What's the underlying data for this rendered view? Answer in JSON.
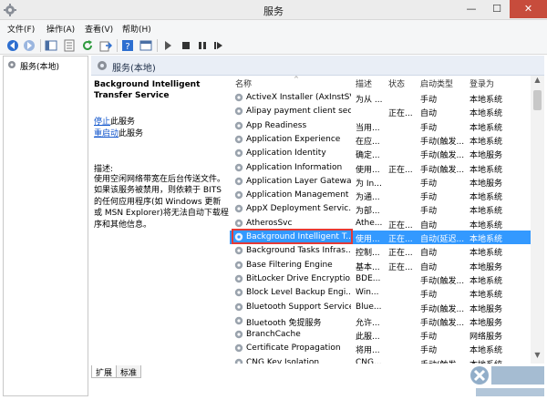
{
  "window": {
    "title": "服务",
    "minimize": "—",
    "maximize": "☐",
    "close": "✕"
  },
  "menu": [
    {
      "label": "文件(F)"
    },
    {
      "label": "操作(A)"
    },
    {
      "label": "查看(V)"
    },
    {
      "label": "帮助(H)"
    }
  ],
  "toolbar": {
    "icons": [
      "back-icon",
      "forward-icon",
      "show-hide-tree-icon",
      "properties-icon",
      "refresh-icon",
      "export-icon",
      "help-icon",
      "mmc-icon",
      "play-icon",
      "stop-icon",
      "pause-icon",
      "restart-icon"
    ]
  },
  "tree": {
    "root_label": "服务(本地)"
  },
  "panel": {
    "header_label": "服务(本地)"
  },
  "description": {
    "service_name": "Background Intelligent Transfer Service",
    "stop_link": "停止",
    "stop_suffix": "此服务",
    "restart_link": "重启动",
    "restart_suffix": "此服务",
    "label": "描述:",
    "text": "使用空闲网络带宽在后台传送文件。如果该服务被禁用，则依赖于 BITS 的任何应用程序(如 Windows 更新或 MSN Explorer)将无法自动下载程序和其他信息。"
  },
  "columns": {
    "name": "名称",
    "desc": "描述",
    "status": "状态",
    "startup": "启动类型",
    "logon": "登录为",
    "sort_indicator": "^"
  },
  "services": [
    {
      "name": "ActiveX Installer (AxInstSV)",
      "desc": "为从 ...",
      "status": "",
      "startup": "手动",
      "logon": "本地系统",
      "selected": false
    },
    {
      "name": "Alipay payment client sec...",
      "desc": "",
      "status": "正在...",
      "startup": "自动",
      "logon": "本地系统",
      "selected": false
    },
    {
      "name": "App Readiness",
      "desc": "当用...",
      "status": "",
      "startup": "手动",
      "logon": "本地系统",
      "selected": false
    },
    {
      "name": "Application Experience",
      "desc": "在应...",
      "status": "",
      "startup": "手动(触发...",
      "logon": "本地系统",
      "selected": false
    },
    {
      "name": "Application Identity",
      "desc": "确定...",
      "status": "",
      "startup": "手动(触发...",
      "logon": "本地服务",
      "selected": false
    },
    {
      "name": "Application Information",
      "desc": "使用...",
      "status": "正在...",
      "startup": "手动(触发...",
      "logon": "本地系统",
      "selected": false
    },
    {
      "name": "Application Layer Gatewa...",
      "desc": "为 In...",
      "status": "",
      "startup": "手动",
      "logon": "本地服务",
      "selected": false
    },
    {
      "name": "Application Management",
      "desc": "为通...",
      "status": "",
      "startup": "手动",
      "logon": "本地系统",
      "selected": false
    },
    {
      "name": "AppX Deployment Servic...",
      "desc": "为部...",
      "status": "",
      "startup": "手动",
      "logon": "本地系统",
      "selected": false
    },
    {
      "name": "AtherosSvc",
      "desc": "Athe...",
      "status": "正在...",
      "startup": "自动",
      "logon": "本地系统",
      "selected": false
    },
    {
      "name": "Background Intelligent T...",
      "desc": "使用...",
      "status": "正在...",
      "startup": "自动(延迟...",
      "logon": "本地系统",
      "selected": true
    },
    {
      "name": "Background Tasks Infras...",
      "desc": "控制...",
      "status": "正在...",
      "startup": "自动",
      "logon": "本地系统",
      "selected": false
    },
    {
      "name": "Base Filtering Engine",
      "desc": "基本...",
      "status": "正在...",
      "startup": "自动",
      "logon": "本地服务",
      "selected": false
    },
    {
      "name": "BitLocker Drive Encryptio...",
      "desc": "BDE...",
      "status": "",
      "startup": "手动(触发...",
      "logon": "本地系统",
      "selected": false
    },
    {
      "name": "Block Level Backup Engi...",
      "desc": "Win...",
      "status": "",
      "startup": "手动",
      "logon": "本地系统",
      "selected": false
    },
    {
      "name": "Bluetooth Support Service",
      "desc": "Blue...",
      "status": "",
      "startup": "手动(触发...",
      "logon": "本地服务",
      "selected": false
    },
    {
      "name": "Bluetooth 免提服务",
      "desc": "允许...",
      "status": "",
      "startup": "手动(触发...",
      "logon": "本地服务",
      "selected": false
    },
    {
      "name": "BranchCache",
      "desc": "此服...",
      "status": "",
      "startup": "手动",
      "logon": "网络服务",
      "selected": false
    },
    {
      "name": "Certificate Propagation",
      "desc": "将用...",
      "status": "",
      "startup": "手动",
      "logon": "本地系统",
      "selected": false
    },
    {
      "name": "CNG Key Isolation",
      "desc": "CNG...",
      "status": "",
      "startup": "手动(触发...",
      "logon": "本地系统",
      "selected": false
    }
  ],
  "tabs": [
    {
      "label": "扩展",
      "active": true
    },
    {
      "label": "标准",
      "active": false
    }
  ],
  "watermark": {
    "brand": "系统城",
    "url": "XITONGCHENG.COM"
  },
  "colors": {
    "selection": "#3399ff",
    "highlight_border": "#e53935",
    "link": "#1155cc",
    "close_button": "#c74c3c"
  }
}
